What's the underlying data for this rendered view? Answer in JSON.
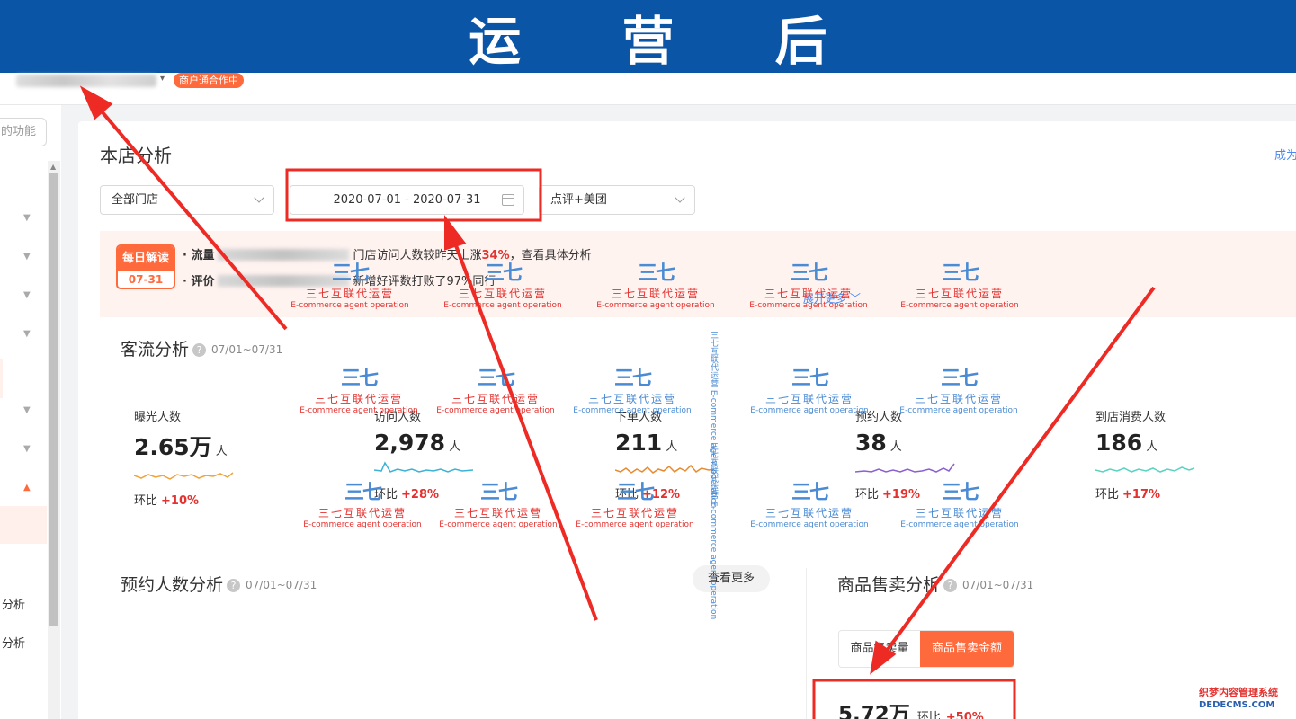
{
  "banner": {
    "title": "运 营 后"
  },
  "merchant": {
    "status_badge": "商户通合作中"
  },
  "sidebar": {
    "func_button": "的功能",
    "labels": [
      "分析",
      "分析"
    ]
  },
  "analysis": {
    "title": "本店分析",
    "top_right_link": "成为",
    "store_select": "全部门店",
    "date_range": "2020-07-01 - 2020-07-31",
    "platform_select": "点评+美团"
  },
  "daily": {
    "badge_title": "每日解读",
    "badge_date": "07-31",
    "line1_prefix": "· 流量",
    "line1_text_a": "门店访问人数较昨天上涨",
    "line1_pct": "34%",
    "line1_text_b": "，查看具体分析",
    "line2_prefix": "· 评价",
    "line2_text": "新增好评数打败了97%同行",
    "expand_link": "展开更多"
  },
  "traffic": {
    "title": "客流分析",
    "date_note": "07/01~07/31",
    "metrics": [
      {
        "label": "曝光人数",
        "value": "2.65万",
        "unit": "人",
        "change_label": "环比",
        "change": "+10%",
        "color": "#f0a33a"
      },
      {
        "label": "访问人数",
        "value": "2,978",
        "unit": "人",
        "change_label": "环比",
        "change": "+28%",
        "color": "#3bb3d6"
      },
      {
        "label": "下单人数",
        "value": "211",
        "unit": "人",
        "change_label": "环比",
        "change": "+12%",
        "color": "#e98a2e"
      },
      {
        "label": "预约人数",
        "value": "38",
        "unit": "人",
        "change_label": "环比",
        "change": "+19%",
        "color": "#8a5fd1"
      },
      {
        "label": "到店消费人数",
        "value": "186",
        "unit": "人",
        "change_label": "环比",
        "change": "+17%",
        "color": "#59d3c1"
      }
    ]
  },
  "reservation": {
    "title": "预约人数分析",
    "date_note": "07/01~07/31",
    "more_button": "查看更多"
  },
  "sales": {
    "title": "商品售卖分析",
    "date_note": "07/01~07/31",
    "tabs": [
      "商品售卖量",
      "商品售卖金额"
    ],
    "active_tab": 1,
    "value": "5.72万",
    "change_label": "环比",
    "change": "+50%"
  },
  "watermark": {
    "logo": "三七",
    "cn": "三七互联代运营",
    "en": "E-commerce agent operation",
    "vertical": "三七互联代运营 E-commerce agent operation"
  },
  "corner_logo": {
    "cn": "织梦内容管理系统",
    "en": "DEDECMS.COM"
  },
  "colors": {
    "banner": "#0a55a6",
    "accent": "#ff6a3d",
    "negative_red": "#e3322f",
    "link_blue": "#4a8af0",
    "annotation_red": "#ee2a24"
  }
}
